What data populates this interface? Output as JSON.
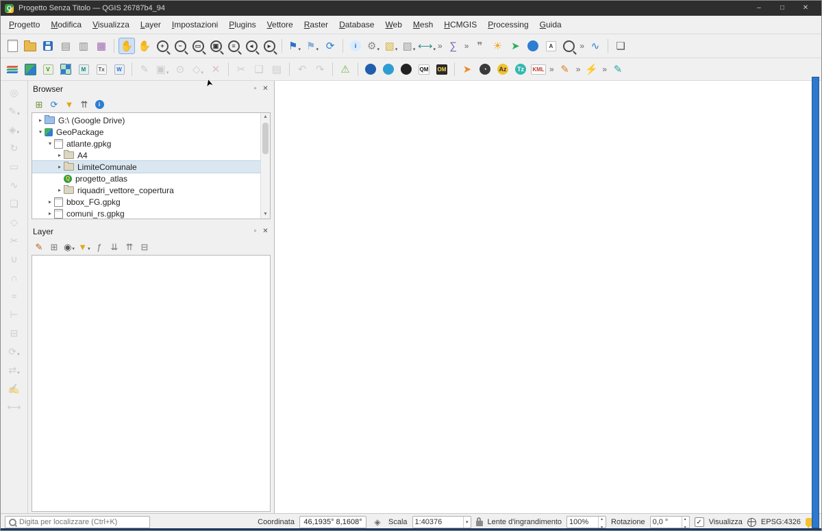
{
  "window": {
    "title": "Progetto Senza Titolo — QGIS 26787b4_94",
    "controls": {
      "minimize": "–",
      "maximize": "□",
      "close": "✕"
    }
  },
  "colors": {
    "titlebar_bg": "#2e2e2e",
    "selected_row_bg": "#dbe7f0",
    "right_edge_accent": "#2e79cc",
    "active_tool_bg": "#cfe0f3"
  },
  "menubar": {
    "items": [
      "Progetto",
      "Modifica",
      "Visualizza",
      "Layer",
      "Impostazioni",
      "Plugins",
      "Vettore",
      "Raster",
      "Database",
      "Web",
      "Mesh",
      "HCMGIS",
      "Processing",
      "Guida"
    ]
  },
  "toolbar_row1": [
    {
      "name": "new-project-icon",
      "kind": "doc"
    },
    {
      "name": "open-project-icon",
      "kind": "folder"
    },
    {
      "name": "save-project-icon",
      "kind": "floppy"
    },
    {
      "name": "new-print-layout-icon",
      "kind": "glyph",
      "text": "▤",
      "color": "#8a8a8a"
    },
    {
      "name": "layout-manager-icon",
      "kind": "glyph",
      "text": "▥",
      "color": "#8a8a8a"
    },
    {
      "name": "style-manager-icon",
      "kind": "glyph",
      "text": "▦",
      "color": "#a06ab0"
    },
    {
      "kind": "sep"
    },
    {
      "name": "pan-map-icon",
      "kind": "glyph",
      "text": "✋",
      "color": "#c98c4d",
      "active": true
    },
    {
      "name": "pan-to-selection-icon",
      "kind": "glyph",
      "text": "✋",
      "color": "#b0b0b0"
    },
    {
      "name": "zoom-in-icon",
      "kind": "mag",
      "text": "+"
    },
    {
      "name": "zoom-out-icon",
      "kind": "mag",
      "text": "−"
    },
    {
      "name": "zoom-full-extent-icon",
      "kind": "mag",
      "text": "▭"
    },
    {
      "name": "zoom-to-selection-icon",
      "kind": "mag",
      "text": "▣"
    },
    {
      "name": "zoom-to-layer-icon",
      "kind": "mag",
      "text": "≡"
    },
    {
      "name": "zoom-last-icon",
      "kind": "mag",
      "text": "◂"
    },
    {
      "name": "zoom-next-icon",
      "kind": "mag",
      "text": "▸"
    },
    {
      "kind": "sep"
    },
    {
      "name": "new-bookmark-icon",
      "kind": "glyph",
      "text": "⚑",
      "color": "#2e6fc9",
      "dd": true
    },
    {
      "name": "show-bookmarks-icon",
      "kind": "glyph",
      "text": "⚑",
      "color": "#8fb0d8",
      "dd": true
    },
    {
      "name": "refresh-map-icon",
      "kind": "glyph",
      "text": "⟳",
      "color": "#1f7fd4"
    },
    {
      "kind": "sep"
    },
    {
      "name": "identify-features-icon",
      "kind": "badge",
      "text": "i",
      "bg": "#d9ecff",
      "color": "#1b62b8"
    },
    {
      "name": "feature-action-icon",
      "kind": "glyph",
      "text": "⚙",
      "color": "#8a8a8a",
      "dd": true
    },
    {
      "name": "select-features-icon",
      "kind": "glyph",
      "text": "▧",
      "color": "#d8b23a",
      "dd": true
    },
    {
      "name": "deselect-features-icon",
      "kind": "glyph",
      "text": "▧",
      "color": "#9a9a9a",
      "dd": true
    },
    {
      "name": "measure-icon",
      "kind": "glyph",
      "text": "⟷",
      "color": "#3a8a8a",
      "dd": true
    },
    {
      "kind": "chev"
    },
    {
      "name": "statistical-summary-icon",
      "kind": "glyph",
      "text": "∑",
      "color": "#7d5fb2"
    },
    {
      "kind": "chev"
    },
    {
      "name": "map-tips-icon",
      "kind": "glyph",
      "text": "❞",
      "color": "#8a8a8a"
    },
    {
      "name": "sun-plugin-icon",
      "kind": "glyph",
      "text": "☀",
      "color": "#f5a623"
    },
    {
      "name": "share-plugin-icon",
      "kind": "glyph",
      "text": "➤",
      "color": "#2eae5a"
    },
    {
      "name": "web-globe-icon",
      "kind": "badge",
      "text": "",
      "bg": "#2d7dd2"
    },
    {
      "name": "text-search-plugin-icon",
      "kind": "sq",
      "text": "A",
      "bg": "#ffffff",
      "color": "#333333"
    },
    {
      "name": "locator-magnifier-icon",
      "kind": "mag",
      "text": ""
    },
    {
      "kind": "chev"
    },
    {
      "name": "profile-chart-icon",
      "kind": "glyph",
      "text": "∿",
      "color": "#2d7dd2"
    },
    {
      "kind": "sep"
    },
    {
      "name": "clipboard-plugin-icon",
      "kind": "glyph",
      "text": "❏",
      "color": "#555555"
    }
  ],
  "toolbar_row2": [
    {
      "name": "data-source-manager-icon",
      "kind": "layers"
    },
    {
      "name": "new-geopackage-icon",
      "kind": "gpkg"
    },
    {
      "name": "add-vector-layer-icon",
      "kind": "sq",
      "text": "V",
      "bg": "#e9f2dd",
      "color": "#3f7d23"
    },
    {
      "name": "add-raster-layer-icon",
      "kind": "checker"
    },
    {
      "name": "add-mesh-layer-icon",
      "kind": "sq",
      "text": "M",
      "bg": "#dff0ef",
      "color": "#2a7a74"
    },
    {
      "name": "add-delimited-text-icon",
      "kind": "sq",
      "text": "Tx",
      "bg": "#f7f7f7",
      "color": "#555555"
    },
    {
      "name": "add-wms-layer-icon",
      "kind": "sq",
      "text": "W",
      "bg": "#e8f0fb",
      "color": "#2d6fb8"
    },
    {
      "kind": "sep"
    },
    {
      "name": "toggle-editing-icon",
      "kind": "glyph",
      "text": "✎",
      "color": "#999999",
      "disabled": true
    },
    {
      "name": "save-edits-icon",
      "kind": "glyph",
      "text": "▣",
      "color": "#999999",
      "disabled": true,
      "dd": true
    },
    {
      "name": "add-feature-icon",
      "kind": "glyph",
      "text": "⊙",
      "color": "#999999",
      "disabled": true
    },
    {
      "name": "vertex-tool-icon",
      "kind": "glyph",
      "text": "◇",
      "color": "#999999",
      "disabled": true,
      "dd": true
    },
    {
      "name": "delete-selected-icon",
      "kind": "glyph",
      "text": "✕",
      "color": "#bb7777",
      "disabled": true
    },
    {
      "kind": "sep"
    },
    {
      "name": "cut-features-icon",
      "kind": "glyph",
      "text": "✂",
      "color": "#999999",
      "disabled": true
    },
    {
      "name": "copy-features-icon",
      "kind": "glyph",
      "text": "❏",
      "color": "#999999",
      "disabled": true
    },
    {
      "name": "paste-features-icon",
      "kind": "glyph",
      "text": "▤",
      "color": "#999999",
      "disabled": true
    },
    {
      "kind": "sep"
    },
    {
      "name": "undo-icon",
      "kind": "glyph",
      "text": "↶",
      "color": "#999999",
      "disabled": true
    },
    {
      "name": "redo-icon",
      "kind": "glyph",
      "text": "↷",
      "color": "#999999",
      "disabled": true
    },
    {
      "kind": "sep"
    },
    {
      "name": "geometry-checker-icon",
      "kind": "glyph",
      "text": "⚠",
      "color": "#7ab648"
    },
    {
      "kind": "sep"
    },
    {
      "name": "search-web-plugin-icon",
      "kind": "badge",
      "text": "",
      "bg": "#1f5fae"
    },
    {
      "name": "globe-plugin-icon",
      "kind": "badge",
      "text": "",
      "bg": "#2d9dd2"
    },
    {
      "name": "binoculars-plugin-icon",
      "kind": "badge",
      "text": "",
      "bg": "#222222"
    },
    {
      "name": "quickmapservices-icon",
      "kind": "sq",
      "text": "QM",
      "bg": "#ffffff",
      "color": "#111111"
    },
    {
      "name": "openmaps-icon",
      "kind": "sq",
      "text": "OM",
      "bg": "#2b2b2b",
      "color": "#ffd24a"
    },
    {
      "kind": "sep"
    },
    {
      "name": "orange-arrow-plugin-icon",
      "kind": "glyph",
      "text": "➤",
      "color": "#f08a24"
    },
    {
      "name": "temporal-clock-icon",
      "kind": "badge",
      "text": "◔",
      "bg": "#3a3a3a",
      "color": "#ffffff"
    },
    {
      "name": "az-plugin-icon",
      "kind": "badge",
      "text": "Az",
      "bg": "#f2c230",
      "color": "#333333"
    },
    {
      "name": "tz-plugin-icon",
      "kind": "badge",
      "text": "Tz",
      "bg": "#35b8b0",
      "color": "#ffffff"
    },
    {
      "name": "kml-tools-icon",
      "kind": "sq",
      "text": "KML",
      "bg": "#ffffff",
      "color": "#c0392b"
    },
    {
      "kind": "chev"
    },
    {
      "name": "sketch-plugin-icon",
      "kind": "glyph",
      "text": "✎",
      "color": "#d9822b"
    },
    {
      "kind": "chev"
    },
    {
      "name": "lightning-plugin-icon",
      "kind": "glyph",
      "text": "⚡",
      "color": "#e67e22"
    },
    {
      "kind": "chev"
    },
    {
      "name": "notes-plugin-icon",
      "kind": "glyph",
      "text": "✎",
      "color": "#2aa6a0"
    }
  ],
  "side_toolbar": [
    {
      "name": "side-pin-labels-icon",
      "kind": "glyph",
      "text": "◎",
      "color": "#9a9a9a",
      "disabled": true
    },
    {
      "name": "side-highlight-labels-icon",
      "kind": "glyph",
      "text": "✎",
      "color": "#9a9a9a",
      "disabled": true,
      "dd": true
    },
    {
      "name": "side-move-label-icon",
      "kind": "glyph",
      "text": "◈",
      "color": "#9a9a9a",
      "disabled": true,
      "dd": true
    },
    {
      "name": "side-rotate-label-icon",
      "kind": "glyph",
      "text": "↻",
      "color": "#9a9a9a",
      "disabled": true
    },
    {
      "name": "side-change-label-icon",
      "kind": "glyph",
      "text": "▭",
      "color": "#9a9a9a",
      "disabled": true
    },
    {
      "name": "side-curve-label-icon",
      "kind": "glyph",
      "text": "∿",
      "color": "#9a9a9a",
      "disabled": true
    },
    {
      "name": "side-copy-style-icon",
      "kind": "glyph",
      "text": "❏",
      "color": "#9a9a9a",
      "disabled": true
    },
    {
      "name": "side-vertex-tool-icon",
      "kind": "glyph",
      "text": "◇",
      "color": "#9a9a9a",
      "disabled": true
    },
    {
      "name": "side-split-features-icon",
      "kind": "glyph",
      "text": "✂",
      "color": "#9a9a9a",
      "disabled": true
    },
    {
      "name": "side-merge-features-icon",
      "kind": "glyph",
      "text": "∪",
      "color": "#9a9a9a",
      "disabled": true
    },
    {
      "name": "side-reshape-icon",
      "kind": "glyph",
      "text": "∩",
      "color": "#9a9a9a",
      "disabled": true
    },
    {
      "name": "side-offset-curve-icon",
      "kind": "glyph",
      "text": "≈",
      "color": "#9a9a9a",
      "disabled": true
    },
    {
      "name": "side-trim-extend-icon",
      "kind": "glyph",
      "text": "⊢",
      "color": "#9a9a9a",
      "disabled": true
    },
    {
      "name": "side-delete-part-icon",
      "kind": "glyph",
      "text": "⊟",
      "color": "#9a9a9a",
      "disabled": true
    },
    {
      "name": "side-rotate-feature-icon",
      "kind": "glyph",
      "text": "⟳",
      "color": "#9a9a9a",
      "disabled": true,
      "dd": true
    },
    {
      "name": "side-move-feature-icon",
      "kind": "glyph",
      "text": "⇄",
      "color": "#9a9a9a",
      "disabled": true,
      "dd": true
    },
    {
      "name": "side-annotation-icon",
      "kind": "glyph",
      "text": "✍",
      "color": "#9a9a9a",
      "disabled": true
    },
    {
      "name": "side-measure-icon",
      "kind": "glyph",
      "text": "⟷",
      "color": "#9a9a9a",
      "disabled": true
    }
  ],
  "browser_panel": {
    "title": "Browser",
    "buttons": [
      {
        "name": "browser-float-panel-icon",
        "kind": "glyph",
        "text": "▫",
        "color": "#555555"
      },
      {
        "name": "browser-close-panel-icon",
        "kind": "glyph",
        "text": "✕",
        "color": "#555555"
      }
    ],
    "toolbar": [
      {
        "name": "add-selected-layers-icon",
        "kind": "glyph",
        "text": "⊞",
        "color": "#6b8f3f"
      },
      {
        "name": "refresh-browser-icon",
        "kind": "glyph",
        "text": "⟳",
        "color": "#1f7fd4"
      },
      {
        "name": "filter-browser-icon",
        "kind": "glyph",
        "text": "▼",
        "color": "#e0a818"
      },
      {
        "name": "collapse-all-icon",
        "kind": "glyph",
        "text": "⇈",
        "color": "#555555"
      },
      {
        "name": "properties-widget-icon",
        "kind": "badge",
        "text": "i",
        "bg": "#2d7dd2",
        "color": "#ffffff"
      }
    ],
    "tree": [
      {
        "label": "G:\\ (Google Drive)",
        "depth": 0,
        "exp": "collapsed",
        "icon": "drive"
      },
      {
        "label": "GeoPackage",
        "depth": 0,
        "exp": "expanded",
        "icon": "geopackage"
      },
      {
        "label": "atlante.gpkg",
        "depth": 1,
        "exp": "expanded",
        "icon": "gpkg"
      },
      {
        "label": "A4",
        "depth": 2,
        "exp": "collapsed",
        "icon": "folder"
      },
      {
        "label": "LimiteComunale",
        "depth": 2,
        "exp": "collapsed",
        "icon": "folder",
        "selected": true
      },
      {
        "label": "progetto_atlas",
        "depth": 2,
        "exp": "none",
        "icon": "qgis"
      },
      {
        "label": "riquadri_vettore_copertura",
        "depth": 2,
        "exp": "collapsed",
        "icon": "folder"
      },
      {
        "label": "bbox_FG.gpkg",
        "depth": 1,
        "exp": "collapsed",
        "icon": "gpkg"
      },
      {
        "label": "comuni_rs.gpkg",
        "depth": 1,
        "exp": "collapsed",
        "icon": "gpkg"
      }
    ]
  },
  "layer_panel": {
    "title": "Layer",
    "buttons": [
      {
        "name": "layer-float-panel-icon",
        "kind": "glyph",
        "text": "▫",
        "color": "#555555"
      },
      {
        "name": "layer-close-panel-icon",
        "kind": "glyph",
        "text": "✕",
        "color": "#555555"
      }
    ],
    "toolbar": [
      {
        "name": "layer-styling-icon",
        "kind": "glyph",
        "text": "✎",
        "color": "#b5651d"
      },
      {
        "name": "add-group-icon",
        "kind": "glyph",
        "text": "⊞",
        "color": "#777777"
      },
      {
        "name": "manage-themes-icon",
        "kind": "glyph",
        "text": "◉",
        "color": "#555555",
        "dd": true
      },
      {
        "name": "filter-legend-icon",
        "kind": "glyph",
        "text": "▼",
        "color": "#e0a818",
        "dd": true
      },
      {
        "name": "filter-expression-icon",
        "kind": "glyph",
        "text": "ƒ",
        "color": "#777777"
      },
      {
        "name": "expand-all-icon",
        "kind": "glyph",
        "text": "⇊",
        "color": "#777777"
      },
      {
        "name": "collapse-all-layers-icon",
        "kind": "glyph",
        "text": "⇈",
        "color": "#777777"
      },
      {
        "name": "remove-layer-icon",
        "kind": "glyph",
        "text": "⊟",
        "color": "#777777"
      }
    ]
  },
  "statusbar": {
    "search_placeholder": "Digita per localizzare (Ctrl+K)",
    "coordinate_label": "Coordinata",
    "coordinate_value": "46,1935° 8,1608°",
    "scale_label": "Scala",
    "scale_value": "1:40376",
    "magnifier_label": "Lente d'ingrandimento",
    "magnifier_value": "100%",
    "rotation_label": "Rotazione",
    "rotation_value": "0,0 °",
    "render_label": "Visualizza",
    "render_checked": true,
    "crs_label": "EPSG:4326"
  }
}
